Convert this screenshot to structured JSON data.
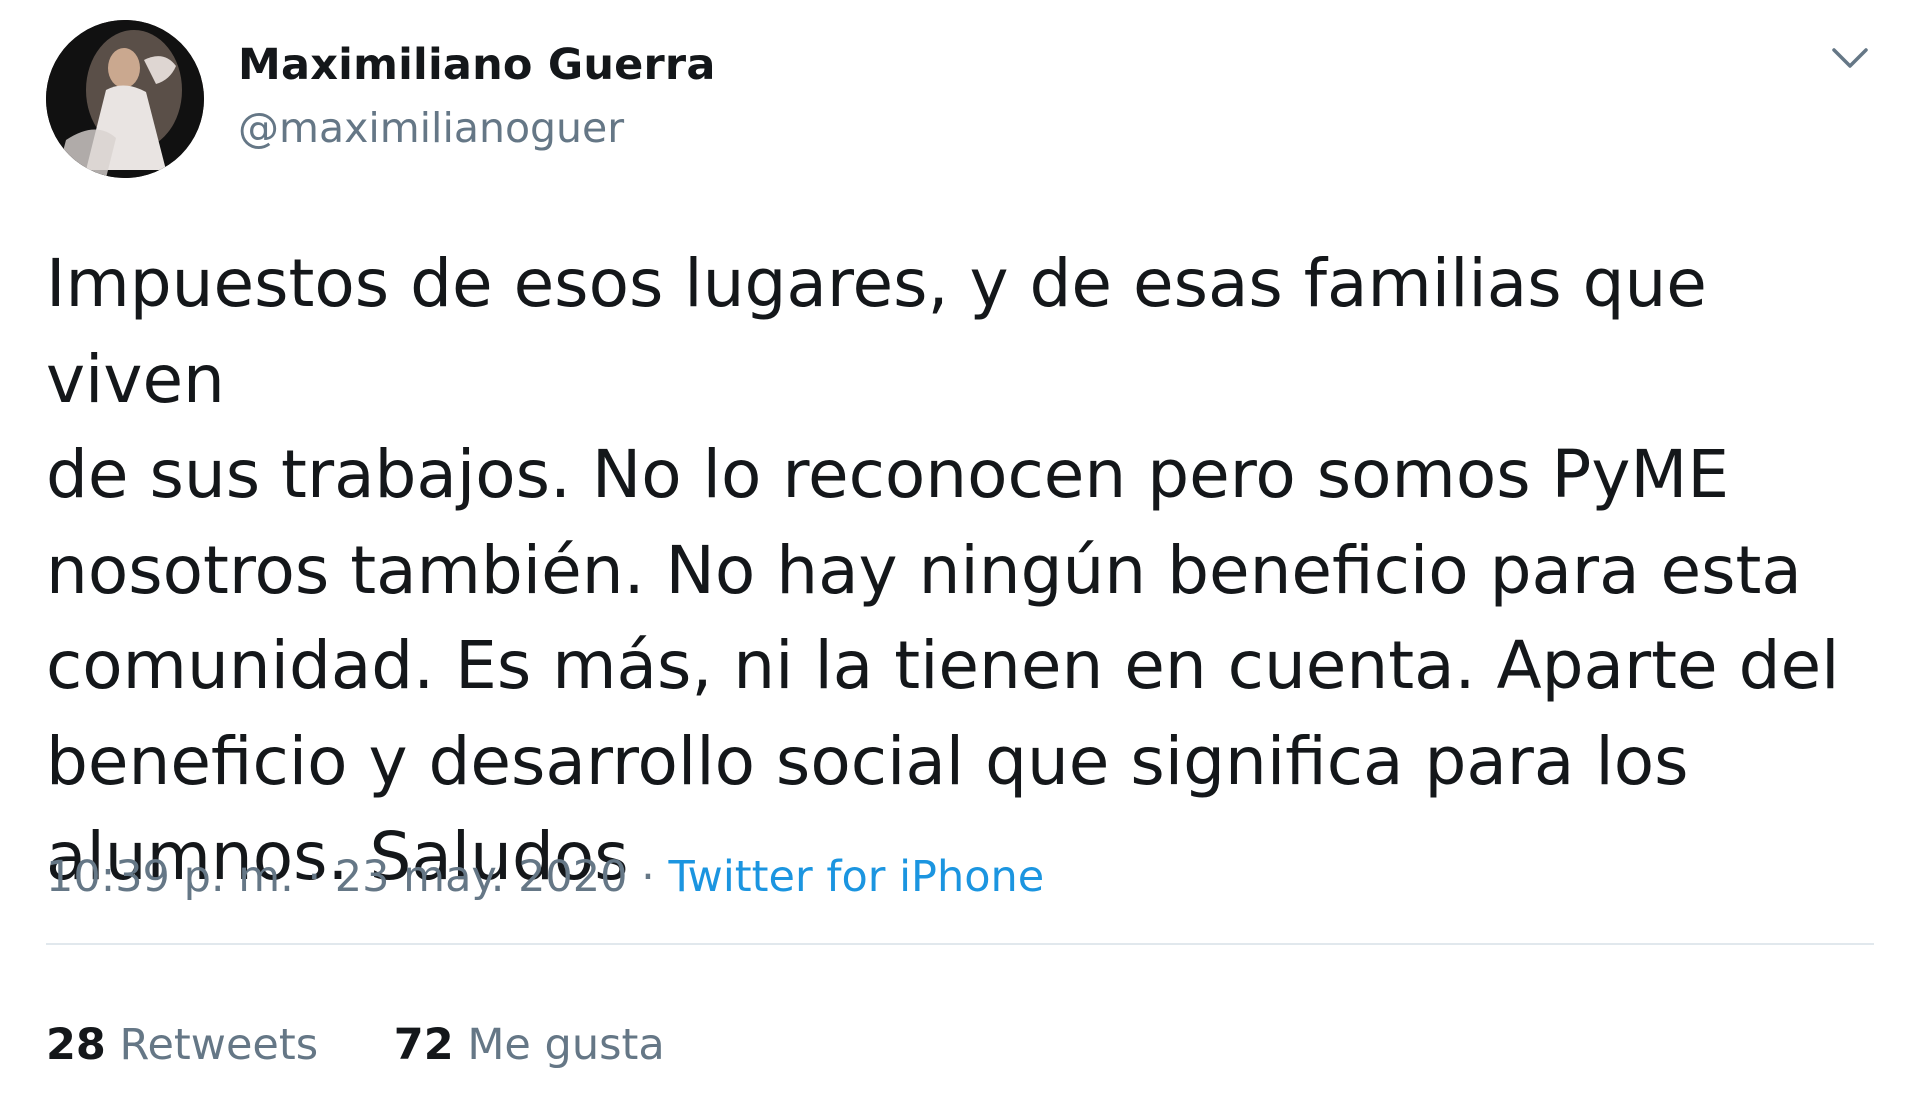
{
  "tweet": {
    "author": {
      "name": "Maximiliano Guerra",
      "handle": "@maximilianoguer",
      "avatar_icon": "profile-photo"
    },
    "text": "Impuestos de esos lugares, y de esas familias que viven\nde sus trabajos. No lo reconocen pero somos PyME\nnosotros también. No hay ningún beneficio para esta\ncomunidad. Es más, ni la tienen en cuenta. Aparte del\nbeneficio y desarrollo social que significa para los\nalumnos. Saludos",
    "time": "10:39 p. m.",
    "separator": " · ",
    "date": "23 may. 2020",
    "source": "Twitter for iPhone",
    "stats": {
      "retweets_count": "28",
      "retweets_label": "Retweets",
      "likes_count": "72",
      "likes_label": "Me gusta"
    },
    "menu_icon": "chevron-down-icon"
  },
  "colors": {
    "text": "#14171a",
    "secondary": "#657786",
    "link": "#1b95e0",
    "divider": "#e1e8ed"
  }
}
